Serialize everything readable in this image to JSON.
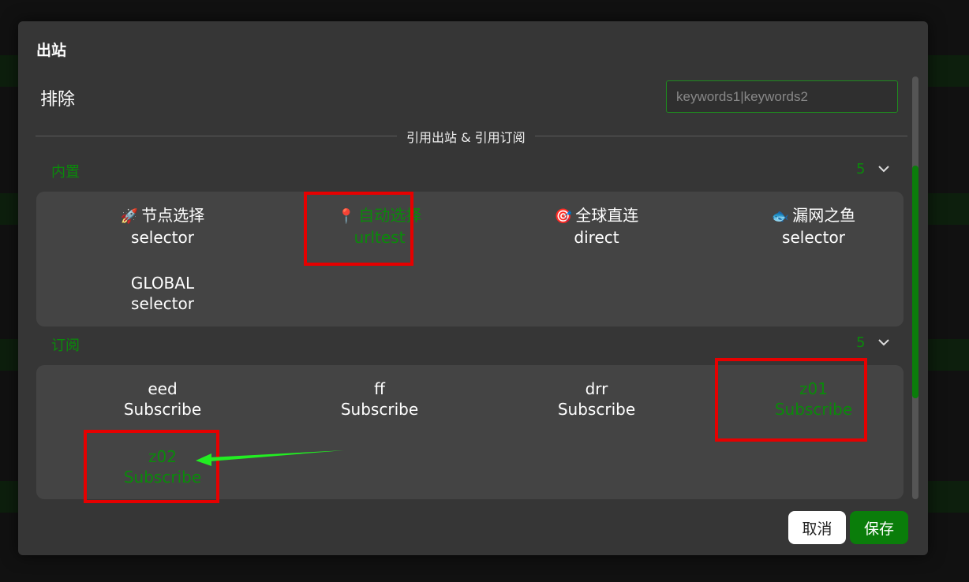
{
  "dialog": {
    "title": "出站",
    "exclude_label": "排除",
    "exclude_placeholder": "keywords1|keywords2",
    "divider_text": "引用出站 & 引用订阅",
    "cancel_label": "取消",
    "save_label": "保存"
  },
  "builtin": {
    "title": "内置",
    "count": "5",
    "items": [
      {
        "emoji": "🚀",
        "name": "节点选择",
        "type": "selector",
        "selected": false
      },
      {
        "emoji": "📍",
        "name": "自动选择",
        "type": "urltest",
        "selected": true
      },
      {
        "emoji": "🎯",
        "name": "全球直连",
        "type": "direct",
        "selected": false
      },
      {
        "emoji": "🐟",
        "name": "漏网之鱼",
        "type": "selector",
        "selected": false
      },
      {
        "emoji": "",
        "name": "GLOBAL",
        "type": "selector",
        "selected": false
      }
    ]
  },
  "subscribe": {
    "title": "订阅",
    "count": "5",
    "items": [
      {
        "name": "eed",
        "type": "Subscribe",
        "selected": false
      },
      {
        "name": "ff",
        "type": "Subscribe",
        "selected": false
      },
      {
        "name": "drr",
        "type": "Subscribe",
        "selected": false
      },
      {
        "name": "z01",
        "type": "Subscribe",
        "selected": true
      },
      {
        "name": "z02",
        "type": "Subscribe",
        "selected": true
      }
    ]
  },
  "colors": {
    "accent": "#0a8a0a",
    "highlight": "#e60000",
    "arrow": "#22ee22"
  }
}
